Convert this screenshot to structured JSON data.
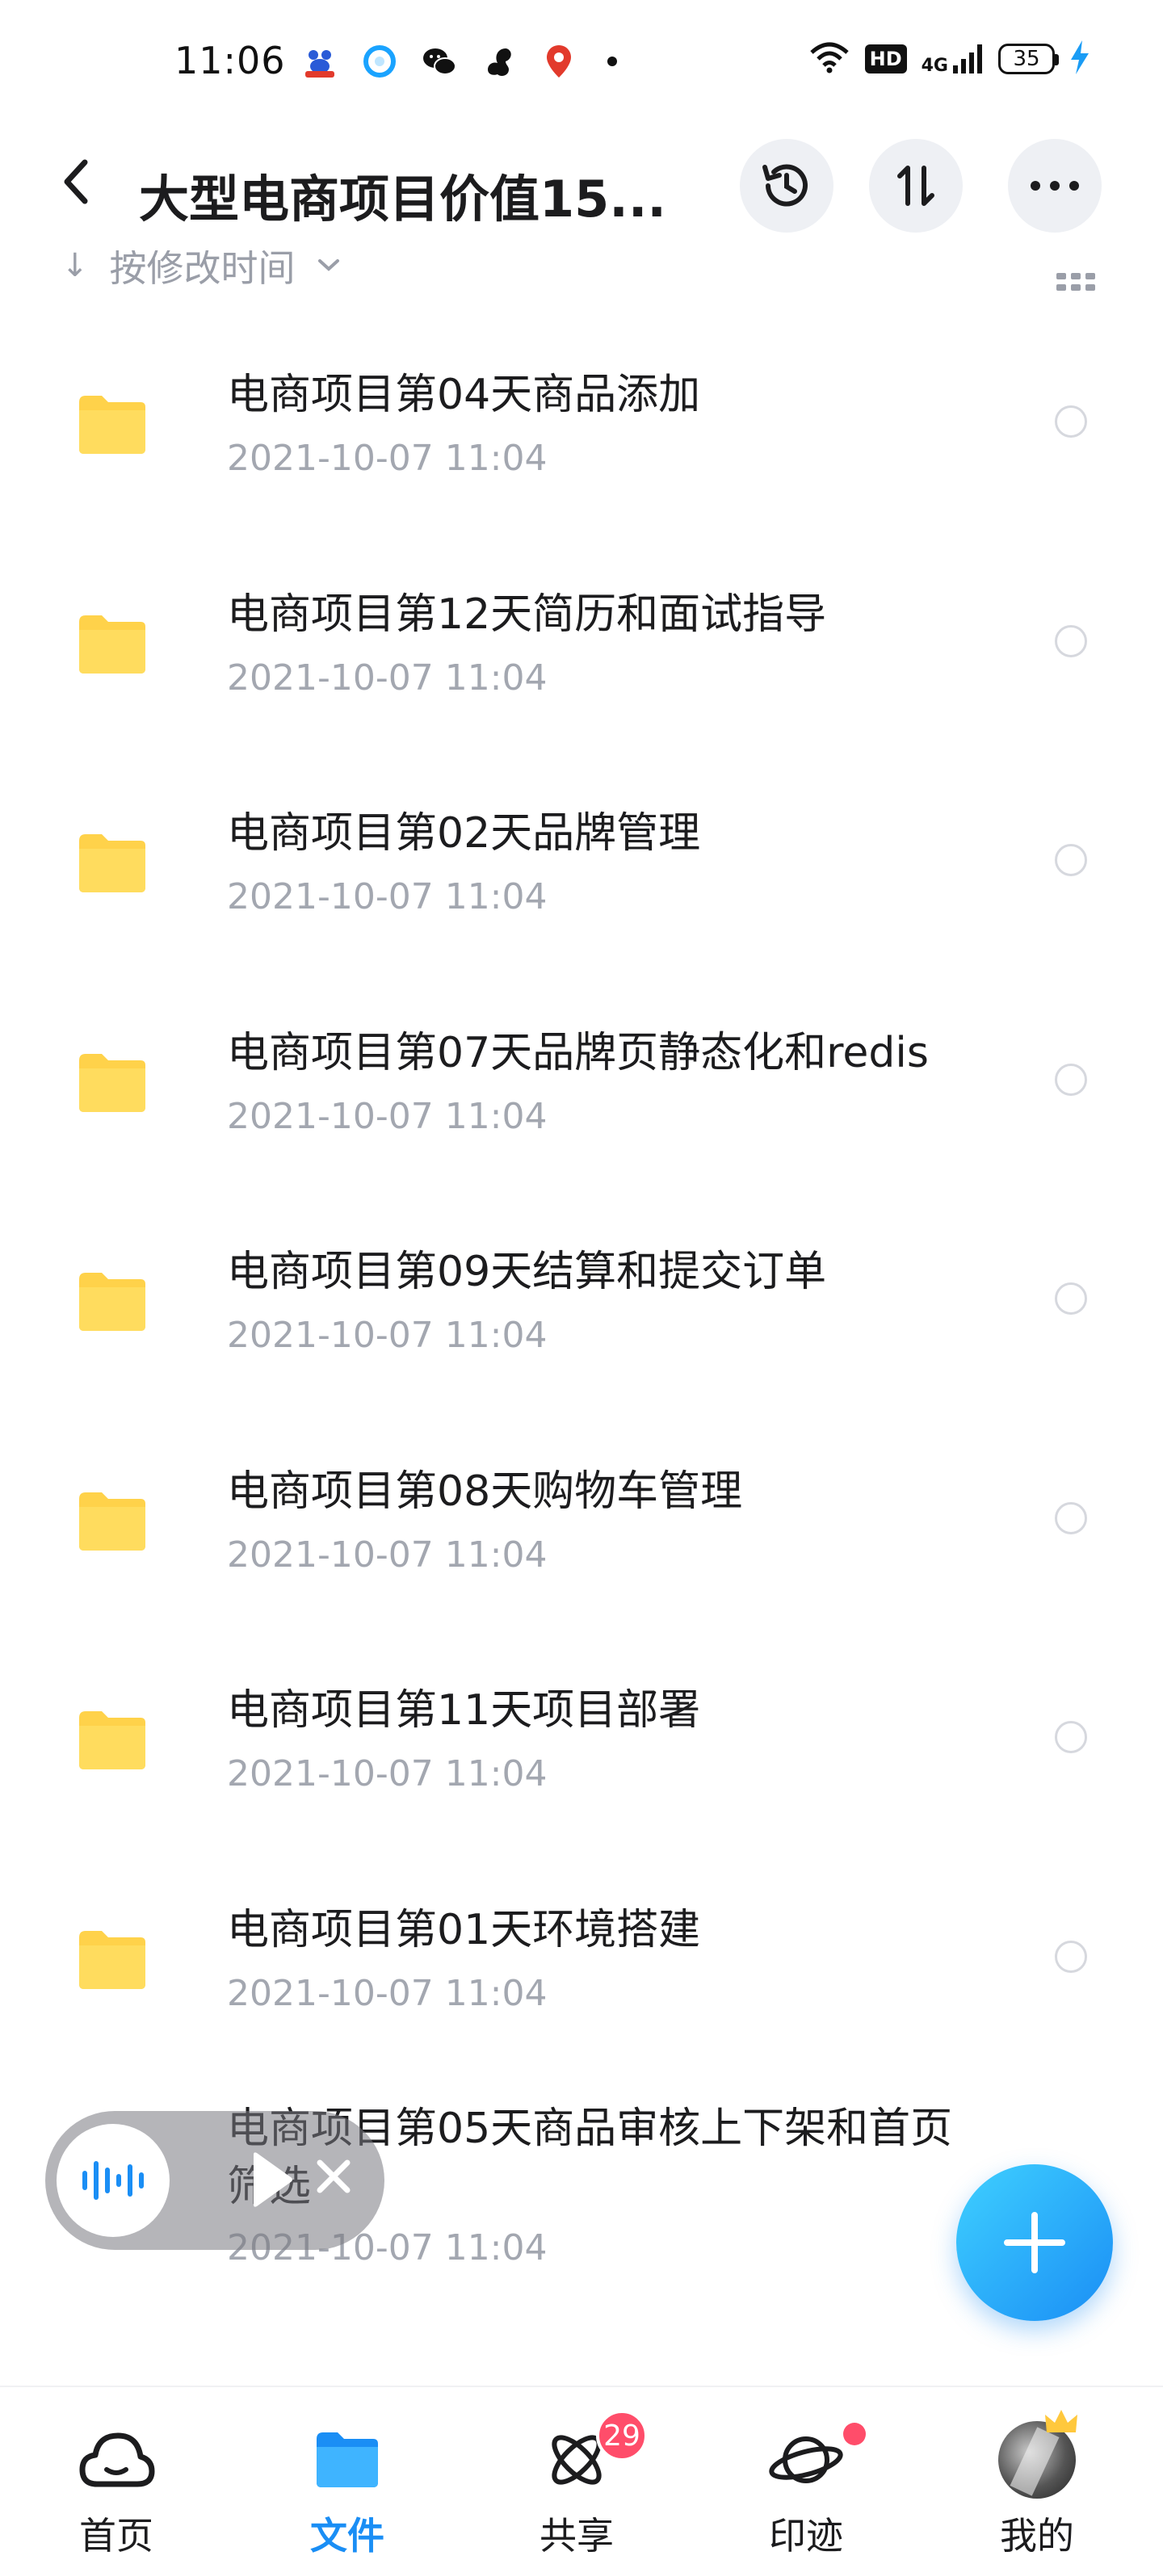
{
  "status_bar": {
    "time": "11:06",
    "app_icons": [
      "baidu-app-icon",
      "browser-app-icon",
      "wechat-icon",
      "squirrel-app-icon",
      "location-app-icon"
    ],
    "hd_label": "HD",
    "network_label": "4G",
    "battery_level": "35"
  },
  "header": {
    "title": "大型电商项目价值15..."
  },
  "sort": {
    "label": "按修改时间"
  },
  "files": [
    {
      "name": "电商项目第04天商品添加",
      "date": "2021-10-07  11:04"
    },
    {
      "name": "电商项目第12天简历和面试指导",
      "date": "2021-10-07  11:04"
    },
    {
      "name": "电商项目第02天品牌管理",
      "date": "2021-10-07  11:04"
    },
    {
      "name": "电商项目第07天品牌页静态化和redis",
      "date": "2021-10-07  11:04"
    },
    {
      "name": "电商项目第09天结算和提交订单",
      "date": "2021-10-07  11:04"
    },
    {
      "name": "电商项目第08天购物车管理",
      "date": "2021-10-07  11:04"
    },
    {
      "name": "电商项目第11天项目部署",
      "date": "2021-10-07  11:04"
    },
    {
      "name": "电商项目第01天环境搭建",
      "date": "2021-10-07  11:04"
    },
    {
      "name": "电商项目第05天商品审核上下架和首页筛选",
      "date": "2021-10-07  11:04"
    }
  ],
  "bottom_nav": {
    "items": [
      {
        "label": "首页",
        "icon": "cloud-icon"
      },
      {
        "label": "文件",
        "icon": "folder-icon"
      },
      {
        "label": "共享",
        "icon": "atom-icon",
        "badge": "29"
      },
      {
        "label": "印迹",
        "icon": "planet-icon"
      },
      {
        "label": "我的",
        "icon": "avatar"
      }
    ]
  },
  "colors": {
    "accent": "#1a8ef5",
    "folder": "#ffd24a",
    "badge": "#ff4d6a",
    "secondary_text": "#a3a7b0"
  }
}
